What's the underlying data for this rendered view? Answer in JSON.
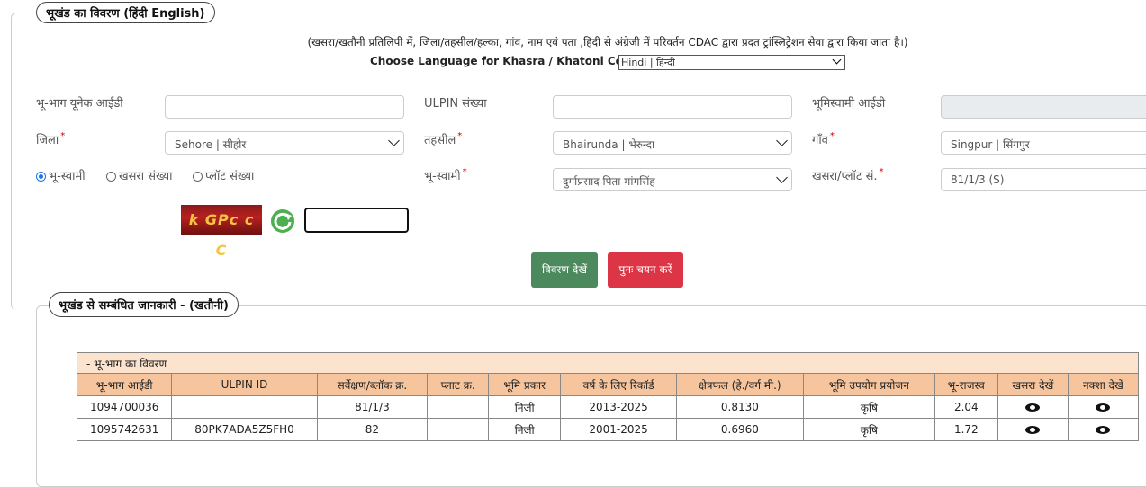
{
  "section1": {
    "legend": "भूखंड का विवरण  (हिंदी  English)",
    "note": "(खसरा/खतौनी प्रतिलिपी में, जिला/तहसील/हल्का, गांव, नाम एवं पता ,हिंदी से अंग्रेजी में परिवर्तन CDAC द्वारा प्रदत ट्रांस्लिट्रेशन सेवा द्वारा किया जाता है।)",
    "choose_label": "Choose Language for Khasra / Khatoni Copy:",
    "language_selected": "Hindi | हिन्दी"
  },
  "form": {
    "unique_id_label": "भू-भाग यूनेक आईडी",
    "unique_id_value": "",
    "ulpin_label": "ULPIN संख्या",
    "ulpin_value": "",
    "owner_id_label": "भूमिस्वामी आईडी",
    "owner_id_value": "",
    "district_label": "जिला",
    "district_value": "Sehore | सीहोर",
    "tehsil_label": "तहसील",
    "tehsil_value": "Bhairunda | भेरुन्दा",
    "village_label": "गाँव",
    "village_value": "Singpur | सिंगपुर",
    "radio_owner": "भू-स्वामी",
    "radio_khasra": "खसरा संख्या",
    "radio_plot": "प्लॉट संख्या",
    "bhuswami_label": "भू-स्वामी",
    "bhuswami_value": "दुर्गाप्रसाद पिता मांगसिंह",
    "khasra_plot_label": "खसरा/प्लॉट सं.",
    "khasra_plot_value": "81/1/3 (S)",
    "required_mark": "*",
    "captcha_text": "k GPc c C",
    "captcha_value": "",
    "view_button": "विवरण देखें",
    "reset_button": "पुनः चयन करें"
  },
  "section2": {
    "legend": "भूखंड से सम्बंधित जानकारी -   (खतौनी)",
    "table_caption": "- भू-भाग का विवरण",
    "headers": [
      "भू-भाग आईडी",
      "ULPIN ID",
      "सर्वेक्षण/ब्लॉक क्र.",
      "प्लाट क्र.",
      "भूमि प्रकार",
      "वर्ष के लिए रिकॉर्ड",
      "क्षेत्रफल (हे./वर्ग मी.)",
      "भूमि उपयोग प्रयोजन",
      "भू-राजस्व",
      "खसरा देखें",
      "नक्शा देखें"
    ],
    "rows": [
      [
        "1094700036",
        "",
        "81/1/3",
        "",
        "निजी",
        "2013-2025",
        "0.8130",
        "कृषि",
        "2.04"
      ],
      [
        "1095742631",
        "80PK7ADA5Z5FH0",
        "82",
        "",
        "निजी",
        "2001-2025",
        "0.6960",
        "कृषि",
        "1.72"
      ]
    ]
  }
}
